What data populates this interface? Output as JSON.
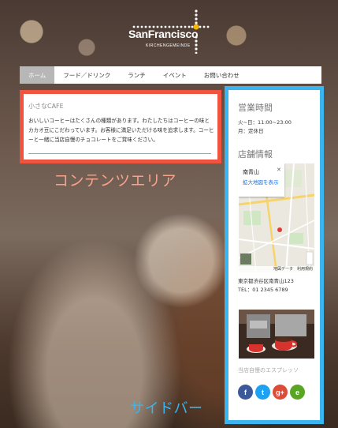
{
  "logo": {
    "title": "SanFrancisco",
    "subtitle": "KIRCHENGEMEINDE"
  },
  "nav": {
    "items": [
      {
        "label": "ホーム"
      },
      {
        "label": "フード／ドリンク"
      },
      {
        "label": "ランチ"
      },
      {
        "label": "イベント"
      },
      {
        "label": "お問い合わせ"
      }
    ]
  },
  "content": {
    "title": "小さなCAFE",
    "text": "おいしいコーヒーはたくさんの種類があります。わたしたちはコーヒーの味とカカオ豆にこだわっています。お客様に満足いただける味を追求します。コーヒーと一緒に当店自慢のチョコレートをご賞味ください。",
    "label": "コンテンツエリア"
  },
  "sidebar": {
    "hours_heading": "営業時間",
    "hours_line1": "火~日：11:00~23:00",
    "hours_line2": "月：定休日",
    "store_heading": "店舗情報",
    "map": {
      "place": "南青山",
      "link": "拡大地図を表示",
      "footer": "地図データ　利用規約"
    },
    "address": "東京都渋谷区南青山123",
    "tel": "TEL：01 2345 6789",
    "photo_caption": "当店自慢のエスプレッソ",
    "social": [
      {
        "name": "facebook",
        "glyph": "f",
        "color": "#3b5998"
      },
      {
        "name": "twitter",
        "glyph": "t",
        "color": "#1da1f2"
      },
      {
        "name": "google-plus",
        "glyph": "g+",
        "color": "#dd4b39"
      },
      {
        "name": "evernote",
        "glyph": "e",
        "color": "#5ba525"
      }
    ],
    "label": "サイドバー"
  },
  "colors": {
    "content_border": "#f0543f",
    "sidebar_border": "#3bb5ef",
    "nav_active": "#b7b7b7"
  }
}
